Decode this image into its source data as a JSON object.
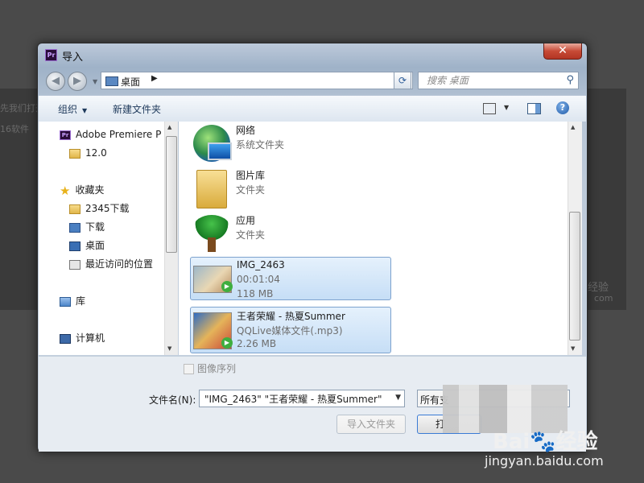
{
  "background": {
    "text_lines": [
      "先我们打开",
      "16软件"
    ],
    "side_text": "经验",
    "side_url": "com"
  },
  "dialog": {
    "title": "导入",
    "app_icon_text": "Pr",
    "close_label": "✕"
  },
  "nav": {
    "back_glyph": "◀",
    "forward_glyph": "▶",
    "address_icon": "desktop-icon",
    "address_text": "桌面",
    "search_placeholder": "搜索 桌面"
  },
  "toolbar": {
    "organize_label": "组织",
    "new_folder_label": "新建文件夹",
    "help_label": "?"
  },
  "sidebar": {
    "items": [
      {
        "label": "Adobe Premiere P",
        "icon": "premiere-icon"
      },
      {
        "label": "12.0",
        "icon": "folder-icon"
      },
      {
        "label": "收藏夹",
        "icon": "star-icon"
      },
      {
        "label": "2345下载",
        "icon": "folder-icon"
      },
      {
        "label": "下载",
        "icon": "download-folder-icon"
      },
      {
        "label": "桌面",
        "icon": "desktop-icon"
      },
      {
        "label": "最近访问的位置",
        "icon": "recent-places-icon"
      },
      {
        "label": "库",
        "icon": "library-icon"
      },
      {
        "label": "计算机",
        "icon": "computer-icon"
      }
    ]
  },
  "files": [
    {
      "name": "网络",
      "line2": "系统文件夹",
      "line3": "",
      "icon": "network-icon",
      "selected": false
    },
    {
      "name": "图片库",
      "line2": "文件夹",
      "line3": "",
      "icon": "folder-icon",
      "selected": false
    },
    {
      "name": "应用",
      "line2": "文件夹",
      "line3": "",
      "icon": "tree-icon",
      "selected": false
    },
    {
      "name": "IMG_2463",
      "line2": "00:01:04",
      "line3": "118 MB",
      "icon": "video-thumbnail-icon",
      "selected": true
    },
    {
      "name": "王者荣耀 - 热夏Summer",
      "line2": "QQLive媒体文件(.mp3)",
      "line3": "2.26 MB",
      "icon": "audio-thumbnail-icon",
      "selected": true
    }
  ],
  "bottom": {
    "image_sequence_label": "图像序列",
    "filename_label": "文件名(N):",
    "filename_value": "\"IMG_2463\" \"王者荣耀 - 热夏Summer\"",
    "filetype_value": "所有支",
    "import_folder_label": "导入文件夹",
    "open_label": "打"
  },
  "watermark": {
    "brand": "Bai🐾经验",
    "url": "jingyan.baidu.com"
  }
}
